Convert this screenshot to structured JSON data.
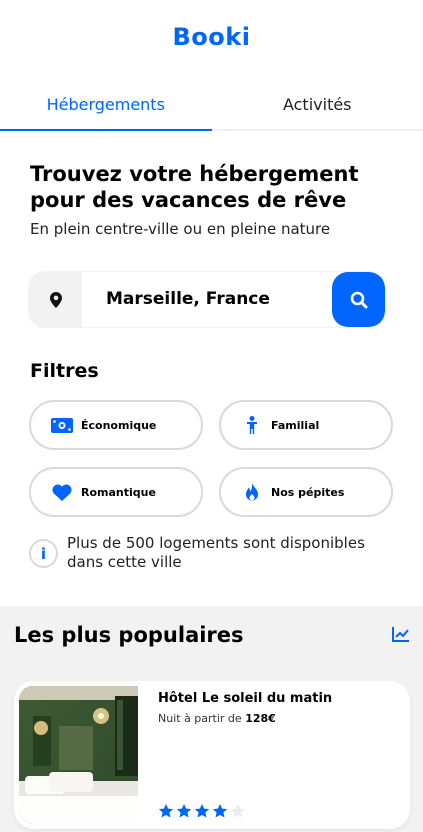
{
  "app": {
    "logo": "Booki",
    "brand_color": "#0065fc"
  },
  "tabs": [
    {
      "label": "Hébergements",
      "active": true
    },
    {
      "label": "Activités",
      "active": false
    }
  ],
  "hero": {
    "title": "Trouvez votre hébergement pour des vacances de rêve",
    "subtitle": "En plein centre-ville ou en pleine nature"
  },
  "search": {
    "value": "Marseille, France",
    "location_icon": "map-pin-icon",
    "button_icon": "search-icon"
  },
  "filters": {
    "title": "Filtres",
    "items": [
      {
        "label": "Économique",
        "icon": "money-bill-icon"
      },
      {
        "label": "Familial",
        "icon": "child-icon"
      },
      {
        "label": "Romantique",
        "icon": "heart-icon"
      },
      {
        "label": "Nos pépites",
        "icon": "fire-icon"
      }
    ]
  },
  "info": {
    "icon_text": "i",
    "text": "Plus de 500 logements sont disponibles dans cette ville"
  },
  "popular": {
    "title": "Les plus populaires",
    "trend_icon": "chart-line-icon",
    "cards": [
      {
        "name": "Hôtel Le soleil du matin",
        "price_prefix": "Nuit à partir de ",
        "price": "128€",
        "rating": 4,
        "rating_max": 5
      }
    ]
  }
}
